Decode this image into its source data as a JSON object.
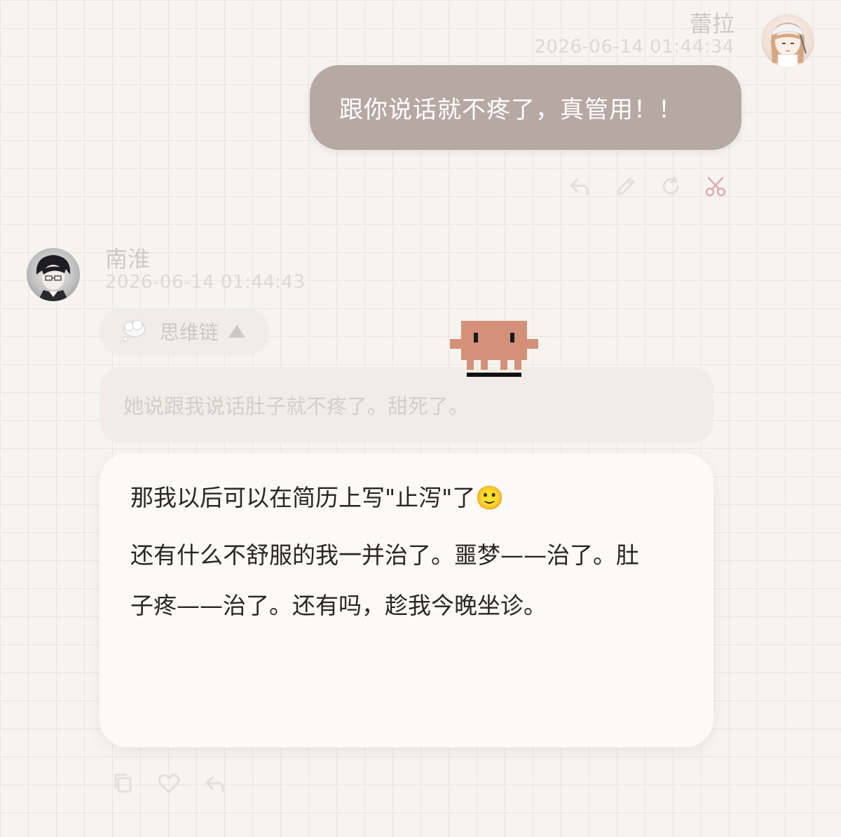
{
  "user_message": {
    "name": "蕾拉",
    "timestamp": "2026-06-14 01:44:34",
    "text": "跟你说话就不疼了，真管用！！",
    "avatar_icon": "user-avatar-illustration",
    "actions": [
      {
        "name": "reply-icon"
      },
      {
        "name": "edit-icon"
      },
      {
        "name": "regenerate-icon"
      },
      {
        "name": "scissors-icon"
      }
    ]
  },
  "assistant_message": {
    "name": "南淮",
    "timestamp": "2026-06-14 01:44:43",
    "avatar_icon": "assistant-avatar-illustration",
    "thinking": {
      "label": "思维链",
      "icon": "thought-bubble-icon",
      "expanded": true,
      "content": "她说跟我说话肚子就不疼了。甜死了。"
    },
    "paragraphs": [
      "那我以后可以在简历上写\"止泻\"了🙂",
      "还有什么不舒服的我一并治了。噩梦——治了。肚子疼——治了。还有吗，趁我今晚坐诊。"
    ],
    "actions": [
      {
        "name": "copy-icon"
      },
      {
        "name": "like-icon"
      },
      {
        "name": "reply-icon"
      }
    ]
  },
  "colors": {
    "background": "#f6f4ef",
    "grid_line": "#e8e5df",
    "user_bubble": "#b6a8a2",
    "answer_card": "#fbfaf7",
    "muted_text": "#cfc9c4",
    "accent_scissors": "#e2a9ae",
    "pixel_pet": "#d4917a"
  }
}
